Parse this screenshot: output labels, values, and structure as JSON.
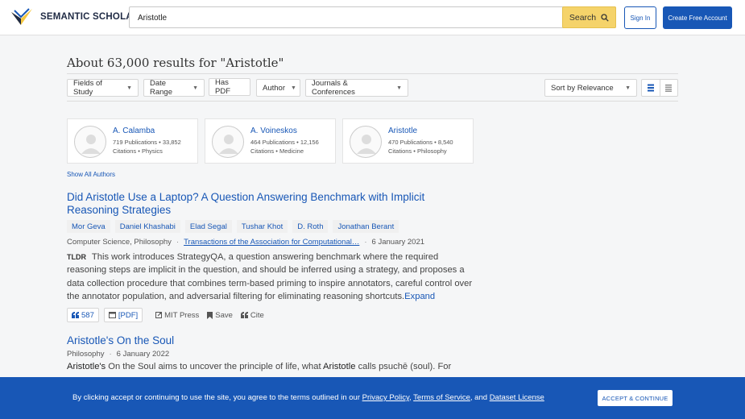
{
  "header": {
    "logo_text": "SEMANTIC SCHOLAR",
    "search_value": "Aristotle",
    "search_button": "Search",
    "sign_in": "Sign In",
    "create_account": "Create Free Account"
  },
  "results": {
    "title": "About 63,000 results for \"Aristotle\""
  },
  "filters": {
    "fields_of_study": "Fields of Study",
    "date_range": "Date Range",
    "has_pdf": "Has PDF",
    "author": "Author",
    "journals": "Journals & Conferences",
    "sort": "Sort by Relevance"
  },
  "authors": [
    {
      "name": "A. Calamba",
      "line1": "719 Publications • 33,852",
      "line2": "Citations • Physics"
    },
    {
      "name": "A. Voineskos",
      "line1": "464 Publications • 12,156",
      "line2": "Citations • Medicine"
    },
    {
      "name": "Aristotle",
      "line1": "470 Publications • 8,540",
      "line2": "Citations • Philosophy"
    }
  ],
  "show_all_authors": "Show All Authors",
  "paper1": {
    "title": "Did Aristotle Use a Laptop? A Question Answering Benchmark with Implicit Reasoning Strategies",
    "authors": [
      "Mor Geva",
      "Daniel Khashabi",
      "Elad Segal",
      "Tushar Khot",
      "D. Roth",
      "Jonathan Berant"
    ],
    "fields": "Computer Science, Philosophy",
    "venue": "Transactions of the Association for Computational…",
    "date": "6 January 2021",
    "tldr_label": "TLDR",
    "tldr": "This work introduces StrategyQA, a question answering benchmark where the required reasoning steps are implicit in the question, and should be inferred using a strategy, and proposes a data collection procedure that combines term-based priming to inspire annotators, careful control over the annotator population, and adversarial filtering for eliminating reasoning shortcuts.",
    "expand": "Expand",
    "citations": "587",
    "pdf": "[PDF]",
    "publisher": "MIT Press",
    "save": "Save",
    "cite": "Cite"
  },
  "paper2": {
    "title": "Aristotle's On the Soul",
    "fields": "Philosophy",
    "date": "6 January 2022",
    "abstract_b1": "Aristotle's",
    "abstract_t1": " On the Soul aims to uncover the principle of life, what ",
    "abstract_b2": "Aristotle",
    "abstract_t2": " calls psuchē (soul). For"
  },
  "cookie": {
    "text_pre": "By clicking accept or continuing to use the site, you agree to the terms outlined in our ",
    "privacy": "Privacy Policy",
    "sep1": ", ",
    "terms": "Terms of Service",
    "sep2": ", and ",
    "dataset": "Dataset License",
    "accept": "ACCEPT & CONTINUE"
  },
  "colors": {
    "brand_blue": "#1857b6",
    "search_yellow": "#f5d36a"
  }
}
